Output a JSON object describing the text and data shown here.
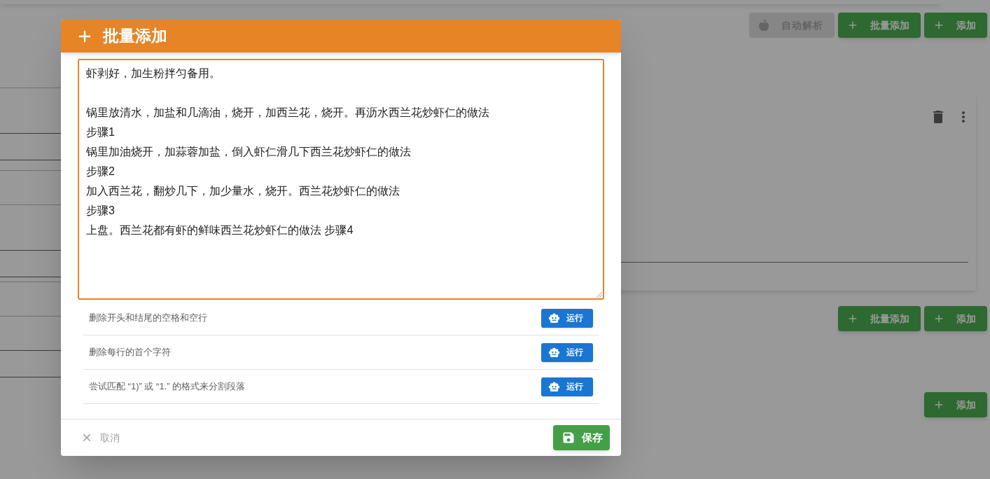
{
  "page": {
    "top_actions": [
      {
        "kind": "parse",
        "label": "自动解析",
        "disabled": true
      },
      {
        "kind": "add",
        "label": "批量添加",
        "disabled": false
      },
      {
        "kind": "add",
        "label": "添加",
        "disabled": false
      }
    ],
    "middle_actions": [
      {
        "kind": "add",
        "label": "批量添加",
        "disabled": false
      },
      {
        "kind": "add",
        "label": "添加",
        "disabled": false
      }
    ],
    "bottom_actions": [
      {
        "kind": "add",
        "label": "添加",
        "disabled": false
      }
    ]
  },
  "dialog": {
    "title": "批量添加",
    "textarea": {
      "focused": true,
      "paragraphs": [
        [
          "虾剥好，加生粉拌匀备用。"
        ],
        [
          "锅里放清水，加盐和几滴油，烧开，加西兰花，烧开。再沥水西兰花炒虾仁的做法",
          "步骤1",
          "锅里加油烧开，加蒜蓉加盐，倒入虾仁滑几下西兰花炒虾仁的做法",
          "步骤2",
          "加入西兰花，翻炒几下，加少量水，烧开。西兰花炒虾仁的做法",
          "步骤3",
          "上盘。西兰花都有虾的鲜味西兰花炒虾仁的做法 步骤4"
        ]
      ]
    },
    "rules": [
      {
        "label": "删除开头和结尾的空格和空行",
        "button": "运行"
      },
      {
        "label": "删除每行的首个字符",
        "button": "运行"
      },
      {
        "label": "尝试匹配 “1)” 或 “1.” 的格式来分割段落",
        "button": "运行"
      }
    ],
    "cancel": "取消",
    "save": "保存"
  }
}
